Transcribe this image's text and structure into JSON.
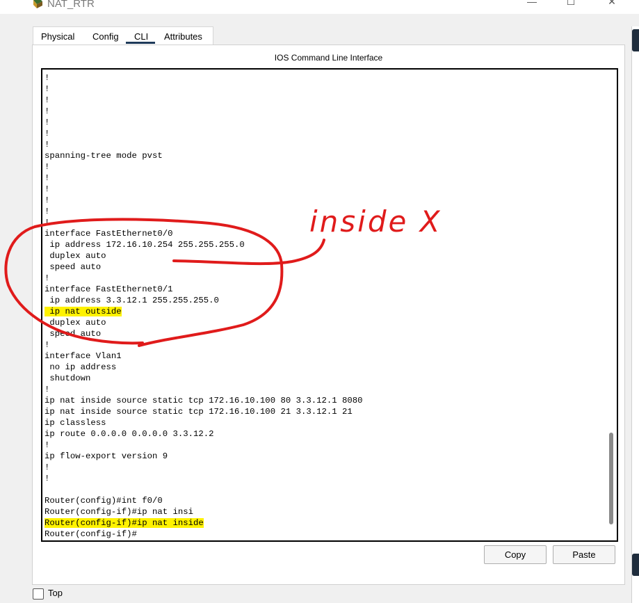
{
  "window": {
    "title": "NAT_RTR",
    "minimize": "—",
    "maximize": "☐",
    "close": "✕"
  },
  "tabs": [
    {
      "label": "Physical"
    },
    {
      "label": "Config"
    },
    {
      "label": "CLI",
      "active": true
    },
    {
      "label": "Attributes"
    }
  ],
  "panel": {
    "title": "IOS Command Line Interface"
  },
  "terminal": {
    "lines": [
      {
        "text": "!"
      },
      {
        "text": "!"
      },
      {
        "text": "!"
      },
      {
        "text": "!"
      },
      {
        "text": "!"
      },
      {
        "text": "!"
      },
      {
        "text": "!"
      },
      {
        "text": "spanning-tree mode pvst"
      },
      {
        "text": "!"
      },
      {
        "text": "!"
      },
      {
        "text": "!"
      },
      {
        "text": "!"
      },
      {
        "text": "!"
      },
      {
        "text": "!"
      },
      {
        "text": "interface FastEthernet0/0"
      },
      {
        "text": " ip address 172.16.10.254 255.255.255.0"
      },
      {
        "text": " duplex auto"
      },
      {
        "text": " speed auto"
      },
      {
        "text": "!"
      },
      {
        "text": "interface FastEthernet0/1"
      },
      {
        "text": " ip address 3.3.12.1 255.255.255.0"
      },
      {
        "text": " ip nat outside",
        "highlight": true
      },
      {
        "text": " duplex auto"
      },
      {
        "text": " speed auto"
      },
      {
        "text": "!"
      },
      {
        "text": "interface Vlan1"
      },
      {
        "text": " no ip address"
      },
      {
        "text": " shutdown"
      },
      {
        "text": "!"
      },
      {
        "text": "ip nat inside source static tcp 172.16.10.100 80 3.3.12.1 8080"
      },
      {
        "text": "ip nat inside source static tcp 172.16.10.100 21 3.3.12.1 21"
      },
      {
        "text": "ip classless"
      },
      {
        "text": "ip route 0.0.0.0 0.0.0.0 3.3.12.2"
      },
      {
        "text": "!"
      },
      {
        "text": "ip flow-export version 9"
      },
      {
        "text": "!"
      },
      {
        "text": "!"
      },
      {
        "text": ""
      },
      {
        "text": "Router(config)#int f0/0"
      },
      {
        "text": "Router(config-if)#ip nat insi"
      },
      {
        "text": "Router(config-if)#ip nat inside",
        "highlight": true
      },
      {
        "text": "Router(config-if)#"
      }
    ]
  },
  "buttons": {
    "copy": "Copy",
    "paste": "Paste"
  },
  "top_checkbox": {
    "label": "Top",
    "checked": false
  },
  "annotation": {
    "text": "inside X",
    "color": "#e01b1b"
  },
  "colors": {
    "highlight": "#fff200",
    "active_tab_underline": "#1e3a5a"
  }
}
